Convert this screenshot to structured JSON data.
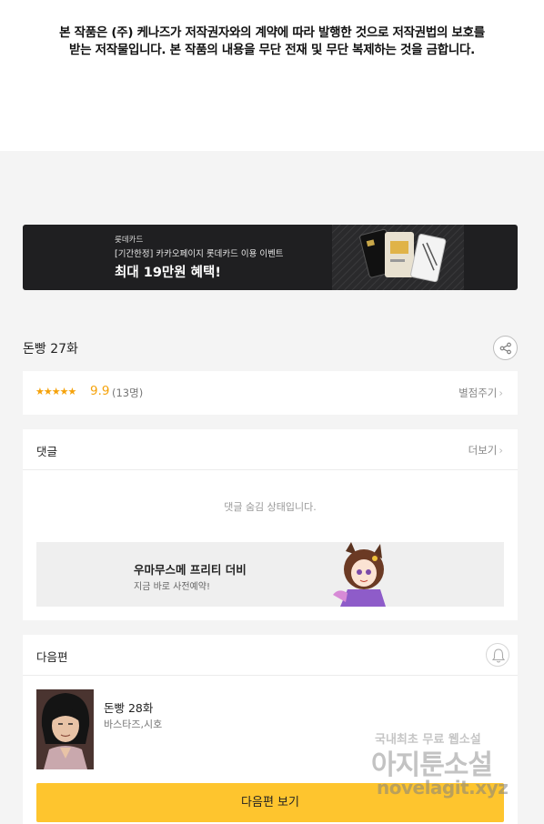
{
  "copyright": {
    "line1": "본 작품은 (주) 케나즈가 저작권자와의 계약에 따라 발행한 것으로 저작권법의 보호를",
    "line2": "받는 저작물입니다. 본 작품의 내용을 무단 전재 및 무단 복제하는 것을 금합니다."
  },
  "banner": {
    "brand": "롯데카드",
    "subtitle": "[기간한정] 카카오페이지 롯데카드 이용 이벤트",
    "headline": "최대 19만원 혜택!"
  },
  "episode": {
    "title": "돈빵 27화"
  },
  "rating": {
    "stars": "★★★★★",
    "score": "9.9",
    "count": "(13명)",
    "rate_label": "별점주기",
    "star_fraction": 0.99
  },
  "comments": {
    "title": "댓글",
    "more_label": "더보기",
    "hidden_message": "댓글 숨김 상태입니다."
  },
  "ad": {
    "title": "우마무스메 프리티 더비",
    "subtitle": "지금 바로 사전예약!"
  },
  "next_episode": {
    "section_title": "다음편",
    "name": "돈빵 28화",
    "authors": "바스타즈,시호",
    "button_label": "다음편 보기"
  },
  "watermark": {
    "line1": "국내최초 무료 웹소설",
    "line2": "아지툰소설",
    "line3": "novelagit.xyz"
  },
  "icons": {
    "share": "share-icon",
    "bell": "bell-icon",
    "chevron": "chevron-right-icon"
  },
  "colors": {
    "accent": "#fec52e",
    "star": "#f5a20a",
    "banner_bg": "#1f1f21"
  }
}
